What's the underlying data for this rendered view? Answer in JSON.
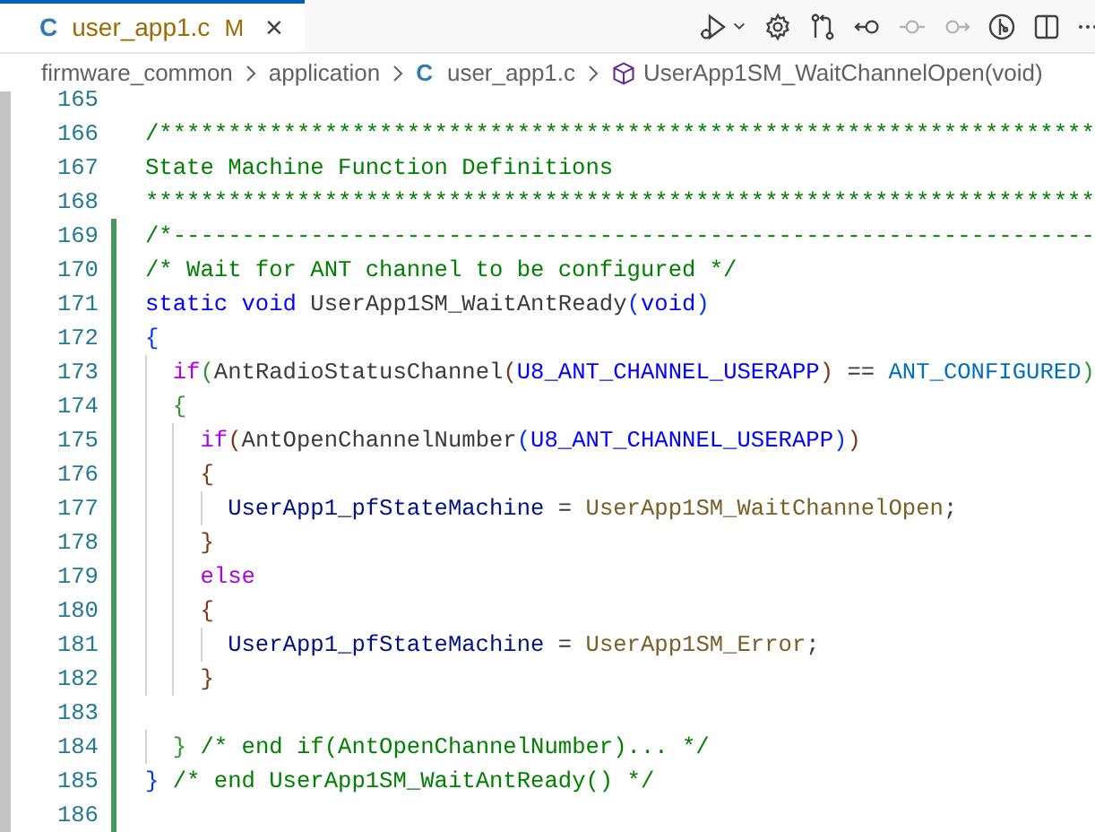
{
  "tab": {
    "file_icon": "C",
    "label": "user_app1.c",
    "badge": "M",
    "close": "×",
    "selected": true
  },
  "toolbar": [
    {
      "kind": "run",
      "disabled": false
    },
    {
      "kind": "settings",
      "disabled": false
    },
    {
      "kind": "compare",
      "disabled": false
    },
    {
      "kind": "back",
      "disabled": false
    },
    {
      "kind": "dot",
      "disabled": true
    },
    {
      "kind": "forward",
      "disabled": true
    },
    {
      "kind": "timeline",
      "disabled": false
    },
    {
      "kind": "split",
      "disabled": false
    },
    {
      "kind": "more",
      "disabled": false
    }
  ],
  "breadcrumb": [
    {
      "kind": "folder",
      "label": "firmware_common"
    },
    {
      "kind": "folder",
      "label": "application"
    },
    {
      "kind": "file",
      "icon": "C",
      "label": "user_app1.c"
    },
    {
      "kind": "symbol",
      "label": "UserApp1SM_WaitChannelOpen(void)"
    }
  ],
  "lines": [
    {
      "number": "165",
      "modified": false
    },
    {
      "number": "166",
      "modified": false,
      "tokens": [
        {
          "text": "/********************************************************************",
          "kind": "c"
        }
      ]
    },
    {
      "number": "167",
      "modified": false,
      "tokens": [
        {
          "text": "State Machine Function Definitions",
          "kind": "c"
        }
      ]
    },
    {
      "number": "168",
      "modified": false,
      "tokens": [
        {
          "text": "*********************************************************************",
          "kind": "c"
        }
      ]
    },
    {
      "number": "169",
      "modified": true,
      "tokens": [
        {
          "text": "/*-------------------------------------------------------------------",
          "kind": "c"
        }
      ]
    },
    {
      "number": "170",
      "modified": true,
      "tokens": [
        {
          "text": "/* Wait for ANT channel to be configured */",
          "kind": "c"
        }
      ]
    },
    {
      "number": "171",
      "modified": true,
      "tokens": [
        {
          "text": "static",
          "kind": "k"
        },
        {
          "text": " void",
          "kind": "k"
        },
        {
          "text": " UserApp1SM_WaitAntReady",
          "kind": "t"
        },
        {
          "text": "(",
          "kind": "b1"
        },
        {
          "text": "void",
          "kind": "k"
        },
        {
          "text": ")",
          "kind": "b1"
        }
      ]
    },
    {
      "number": "172",
      "modified": true,
      "tokens": [
        {
          "text": "{",
          "kind": "b1"
        }
      ]
    },
    {
      "number": "173",
      "modified": true,
      "tokens": [
        {
          "text": "  if",
          "kind": "ctl"
        },
        {
          "text": "(",
          "kind": "b2"
        },
        {
          "text": "AntRadioStatusChannel",
          "kind": "t"
        },
        {
          "text": "(",
          "kind": "b3"
        },
        {
          "text": "U8_ANT_CHANNEL_USERAPP",
          "kind": "m"
        },
        {
          "text": ")",
          "kind": "b3"
        },
        {
          "text": " == ",
          "kind": "t"
        },
        {
          "text": "ANT_CONFIGURED",
          "kind": "e"
        },
        {
          "text": ")",
          "kind": "b2"
        }
      ]
    },
    {
      "number": "174",
      "modified": true,
      "tokens": [
        {
          "text": "  {",
          "kind": "b2"
        }
      ]
    },
    {
      "number": "175",
      "modified": true,
      "tokens": [
        {
          "text": "    if",
          "kind": "ctl"
        },
        {
          "text": "(",
          "kind": "b3"
        },
        {
          "text": "AntOpenChannelNumber",
          "kind": "t"
        },
        {
          "text": "(",
          "kind": "b1"
        },
        {
          "text": "U8_ANT_CHANNEL_USERAPP",
          "kind": "m"
        },
        {
          "text": ")",
          "kind": "b1"
        },
        {
          "text": ")",
          "kind": "b3"
        }
      ]
    },
    {
      "number": "176",
      "modified": true,
      "tokens": [
        {
          "text": "    {",
          "kind": "b3"
        }
      ]
    },
    {
      "number": "177",
      "modified": true,
      "tokens": [
        {
          "text": "      UserApp1_pfStateMachine",
          "kind": "v"
        },
        {
          "text": " = ",
          "kind": "t"
        },
        {
          "text": "UserApp1SM_WaitChannelOpen",
          "kind": "f"
        },
        {
          "text": ";",
          "kind": "t"
        }
      ]
    },
    {
      "number": "178",
      "modified": true,
      "tokens": [
        {
          "text": "    }",
          "kind": "b3"
        }
      ]
    },
    {
      "number": "179",
      "modified": true,
      "tokens": [
        {
          "text": "    else",
          "kind": "ctl"
        }
      ]
    },
    {
      "number": "180",
      "modified": true,
      "tokens": [
        {
          "text": "    {",
          "kind": "b3"
        }
      ]
    },
    {
      "number": "181",
      "modified": true,
      "tokens": [
        {
          "text": "      UserApp1_pfStateMachine",
          "kind": "v"
        },
        {
          "text": " = ",
          "kind": "t"
        },
        {
          "text": "UserApp1SM_Error",
          "kind": "f"
        },
        {
          "text": ";",
          "kind": "t"
        }
      ]
    },
    {
      "number": "182",
      "modified": true,
      "tokens": [
        {
          "text": "    }",
          "kind": "b3"
        }
      ]
    },
    {
      "number": "183",
      "modified": true
    },
    {
      "number": "184",
      "modified": true,
      "tokens": [
        {
          "text": "  }",
          "kind": "b2"
        },
        {
          "text": " /* end if(AntOpenChannelNumber)... */",
          "kind": "c"
        }
      ]
    },
    {
      "number": "185",
      "modified": true,
      "tokens": [
        {
          "text": "}",
          "kind": "b1"
        },
        {
          "text": " /* end UserApp1SM_WaitAntReady() */",
          "kind": "c"
        }
      ]
    },
    {
      "number": "186",
      "modified": true
    }
  ]
}
